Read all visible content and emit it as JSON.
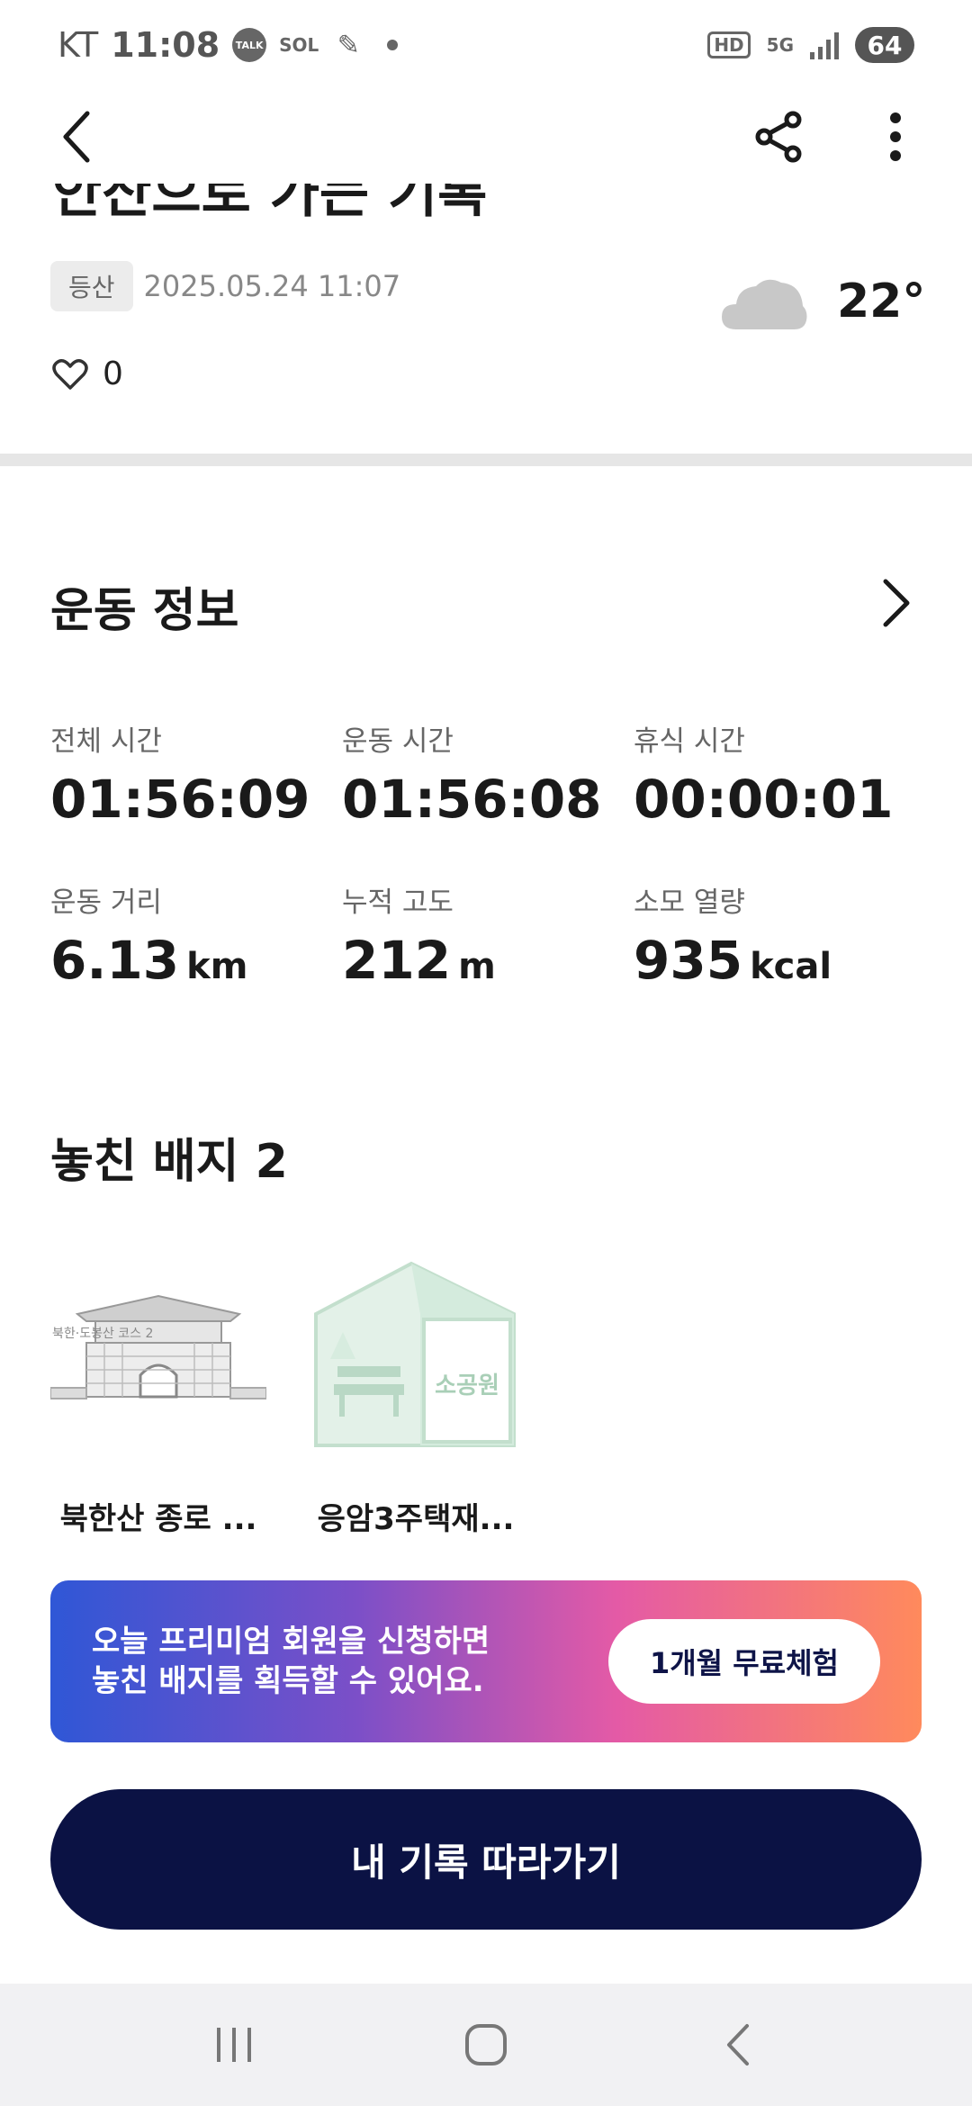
{
  "status_bar": {
    "carrier": "KT",
    "time": "11:08",
    "talk_label": "TALK",
    "sol_label": "SOL",
    "hd_label": "HD",
    "network": "5G",
    "battery": "64"
  },
  "header": {
    "title": "안산으로 가는 기록",
    "tag": "등산",
    "datetime": "2025.05.24 11:07",
    "temperature": "22°",
    "like_count": "0"
  },
  "exercise_info": {
    "title": "운동 정보",
    "stats": [
      {
        "label": "전체 시간",
        "value": "01:56:09",
        "unit": ""
      },
      {
        "label": "운동 시간",
        "value": "01:56:08",
        "unit": ""
      },
      {
        "label": "휴식 시간",
        "value": "00:00:01",
        "unit": ""
      },
      {
        "label": "운동 거리",
        "value": "6.13",
        "unit": "km"
      },
      {
        "label": "누적 고도",
        "value": "212",
        "unit": "m"
      },
      {
        "label": "소모 열량",
        "value": "935",
        "unit": "kcal"
      }
    ]
  },
  "missed_badges": {
    "title": "놓친 배지 2",
    "items": [
      {
        "name": "북한산 종로 ...",
        "overlay": "북한·도봉산 코스 2"
      },
      {
        "name": "응암3주택재...",
        "overlay": "소공원"
      }
    ]
  },
  "premium": {
    "line1": "오늘 프리미엄 회원을 신청하면",
    "line2": "놓친 배지를 획득할 수 있어요.",
    "button": "1개월 무료체험"
  },
  "follow_button": "내 기록 따라가기",
  "colors": {
    "primary_dark": "#0b1244",
    "badge_green": "#cfe6d8",
    "divider": "#e6e6e6"
  }
}
